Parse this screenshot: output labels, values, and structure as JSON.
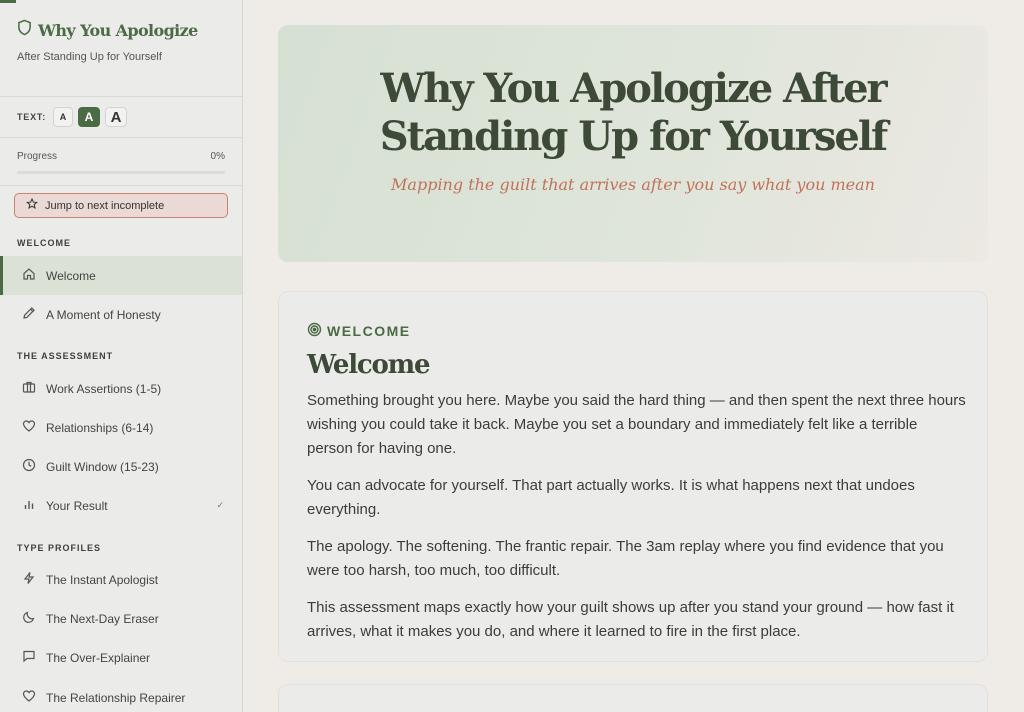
{
  "sidebar": {
    "brand_title": "Why You Apologize",
    "brand_subtitle": "After Standing Up for Yourself",
    "text_size": {
      "label": "TEXT:",
      "small": "A",
      "medium": "A",
      "large": "A"
    },
    "progress": {
      "label": "Progress",
      "value_text": "0%",
      "value": 0
    },
    "jump_label": "Jump to next incomplete",
    "sections": {
      "welcome": "WELCOME",
      "assessment": "THE ASSESSMENT",
      "profiles": "TYPE PROFILES"
    },
    "items": [
      {
        "label": "Welcome",
        "icon": "home-icon"
      },
      {
        "label": "A Moment of Honesty",
        "icon": "pencil-icon"
      },
      {
        "label": "Work Assertions (1-5)",
        "icon": "briefcase-icon"
      },
      {
        "label": "Relationships (6-14)",
        "icon": "heart-icon"
      },
      {
        "label": "Guilt Window (15-23)",
        "icon": "clock-icon"
      },
      {
        "label": "Your Result",
        "icon": "bar-chart-icon"
      },
      {
        "label": "The Instant Apologist",
        "icon": "lightning-icon"
      },
      {
        "label": "The Next-Day Eraser",
        "icon": "moon-icon"
      },
      {
        "label": "The Over-Explainer",
        "icon": "speech-bubble-icon"
      },
      {
        "label": "The Relationship Repairer",
        "icon": "heart-icon"
      }
    ]
  },
  "hero": {
    "title": "Why You Apologize After Standing Up for Yourself",
    "subtitle": "Mapping the guilt that arrives after you say what you mean"
  },
  "welcome_card": {
    "eyebrow": "WELCOME",
    "title": "Welcome",
    "paragraphs": [
      "Something brought you here. Maybe you said the hard thing — and then spent the next three hours wishing you could take it back. Maybe you set a boundary and immediately felt like a terrible person for having one.",
      "You can advocate for yourself. That part actually works. It is what happens next that undoes everything.",
      "The apology. The softening. The frantic repair. The 3am replay where you find evidence that you were too harsh, too much, too difficult.",
      "This assessment maps exactly how your guilt shows up after you stand your ground — how fast it arrives, what it makes you do, and where it learned to fire in the first place."
    ]
  },
  "colors": {
    "accent": "#4b6b44",
    "highlight": "#c27259",
    "active_bg": "#dbe2d5"
  }
}
